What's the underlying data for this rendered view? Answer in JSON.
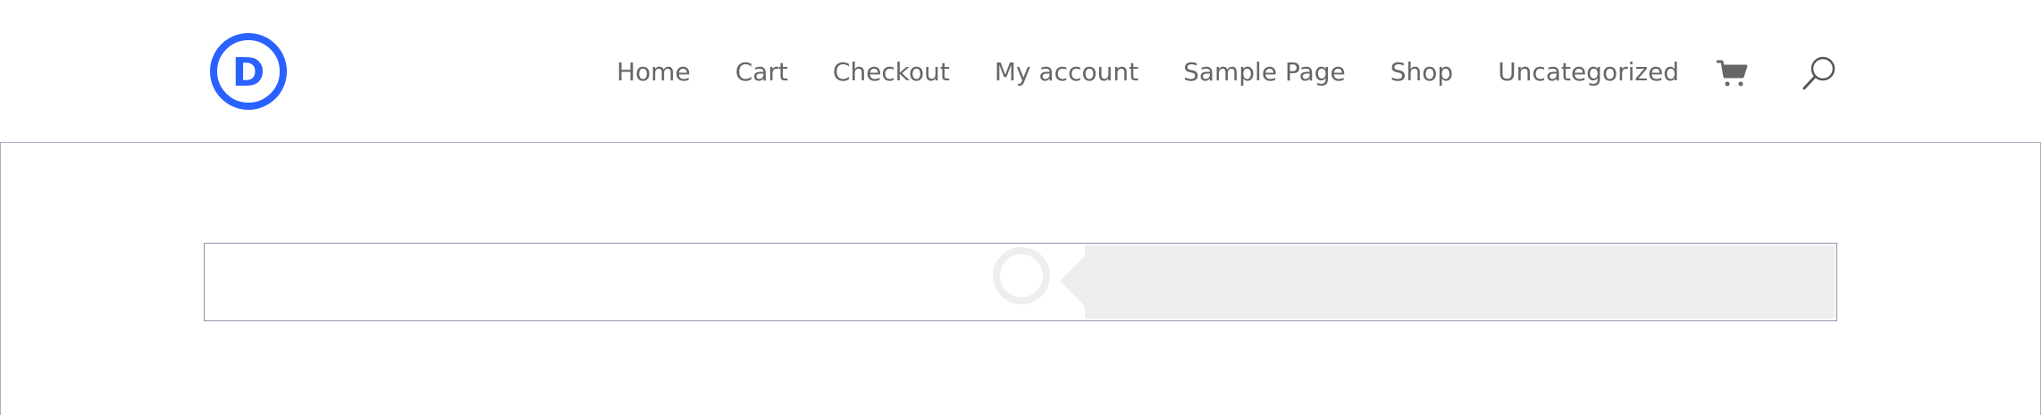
{
  "header": {
    "logo": {
      "letter": "D",
      "icon": "divi-logo-icon",
      "color": "#2962ff"
    },
    "nav": {
      "items": [
        {
          "label": "Home"
        },
        {
          "label": "Cart"
        },
        {
          "label": "Checkout"
        },
        {
          "label": "My account"
        },
        {
          "label": "Sample Page"
        },
        {
          "label": "Shop"
        },
        {
          "label": "Uncategorized"
        }
      ]
    },
    "cart": {
      "icon": "cart-icon"
    },
    "search": {
      "icon": "search-icon"
    }
  },
  "main": {
    "module": {
      "placeholder_icon": "loading-circle-icon",
      "accent": "#eeeeee"
    }
  },
  "colors": {
    "nav_text": "#666666",
    "brand": "#2962ff",
    "border": "#aab0c4"
  }
}
